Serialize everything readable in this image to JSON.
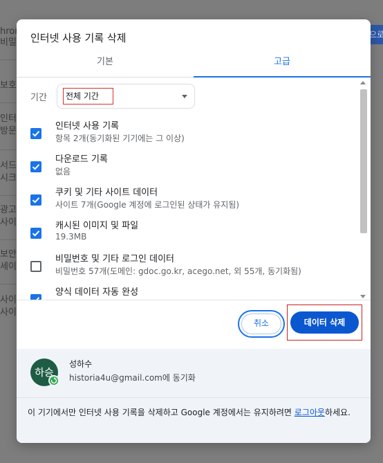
{
  "background": {
    "rows": [
      "hrom",
      "비밀번",
      "보호",
      "인터",
      "방문",
      "서드",
      "시크",
      "광고",
      "사이",
      "보안",
      "세이",
      "사이",
      "사이"
    ],
    "right_button": "으로"
  },
  "dialog": {
    "title": "인터넷 사용 기록 삭제",
    "tabs": [
      {
        "label": "기본",
        "selected": false
      },
      {
        "label": "고급",
        "selected": true
      }
    ],
    "time_range": {
      "label": "기간",
      "value": "전체 기간"
    },
    "options": [
      {
        "title": "인터넷 사용 기록",
        "description": "항목 2개(동기화된 기기에는 그 이상)",
        "checked": true
      },
      {
        "title": "다운로드 기록",
        "description": "없음",
        "checked": true
      },
      {
        "title": "쿠키 및 기타 사이트 데이터",
        "description": "사이트 7개(Google 계정에 로그인된 상태가 유지됨)",
        "checked": true
      },
      {
        "title": "캐시된 이미지 및 파일",
        "description": "19.3MB",
        "checked": true
      },
      {
        "title": "비밀번호 및 기타 로그인 데이터",
        "description": "비밀번호 57개(도메인: gdoc.go.kr, acego.net, 외 55개, 동기화됨)",
        "checked": false
      },
      {
        "title": "양식 데이터 자동 완성",
        "description": "",
        "checked": true
      }
    ],
    "buttons": {
      "cancel": "취소",
      "delete": "데이터 삭제"
    },
    "account": {
      "avatar_text": "하승",
      "name": "성하수",
      "email": "historia4u@gmail.com",
      "email_suffix": "에 동기화"
    },
    "signout_note": {
      "before": "이 기기에서만 인터넷 사용 기록을 삭제하고 Google 계정에서는 유지하려면 ",
      "link": "로그아웃",
      "after": "하세요."
    }
  },
  "colors": {
    "accent": "#1a73e8",
    "primary_button": "#0b57d0",
    "avatar": "#1e5c45",
    "sync_badge": "#34a853",
    "highlight_box": "#c5221f"
  }
}
